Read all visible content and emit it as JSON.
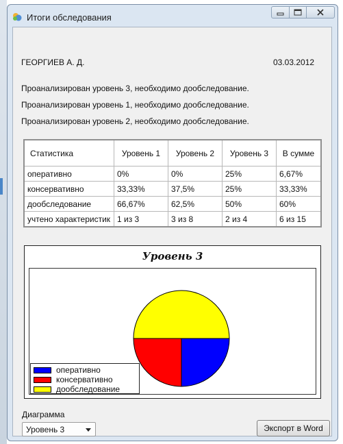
{
  "window": {
    "title": "Итоги обследования"
  },
  "patient": {
    "name": "ГЕОРГИЕВ А. Д.",
    "date": "03.03.2012"
  },
  "messages": [
    "Проанализирован уровень 3, необходимо дообследование.",
    "Проанализирован уровень 1, необходимо дообследование.",
    "Проанализирован уровень 2, необходимо дообследование."
  ],
  "table": {
    "headers": [
      "Статистика",
      "Уровень 1",
      "Уровень 2",
      "Уровень 3",
      "В сумме"
    ],
    "rows": [
      [
        "оперативно",
        "0%",
        "0%",
        "25%",
        "6,67%"
      ],
      [
        "консервативно",
        "33,33%",
        "37,5%",
        "25%",
        "33,33%"
      ],
      [
        "дообследование",
        "66,67%",
        "62,5%",
        "50%",
        "60%"
      ],
      [
        "учтено характеристик",
        "1 из 3",
        "3 из 8",
        "2 из 4",
        "6 из 15"
      ]
    ]
  },
  "chart_data": {
    "type": "pie",
    "title": "Уровень 3",
    "labels": [
      "оперативно",
      "консервативно",
      "дообследование"
    ],
    "values": [
      25,
      25,
      50
    ],
    "colors": [
      "#0000ff",
      "#ff0000",
      "#ffff00"
    ],
    "legend_position": "bottom-left"
  },
  "controls": {
    "diagram_label": "Диаграмма",
    "diagram_selected": "Уровень 3",
    "export_label": "Экспорт в Word"
  },
  "icons": {
    "app": "app-icon",
    "minimize": "minimize-icon",
    "maximize": "maximize-icon",
    "close": "close-icon",
    "dropdown": "chevron-down-icon"
  }
}
